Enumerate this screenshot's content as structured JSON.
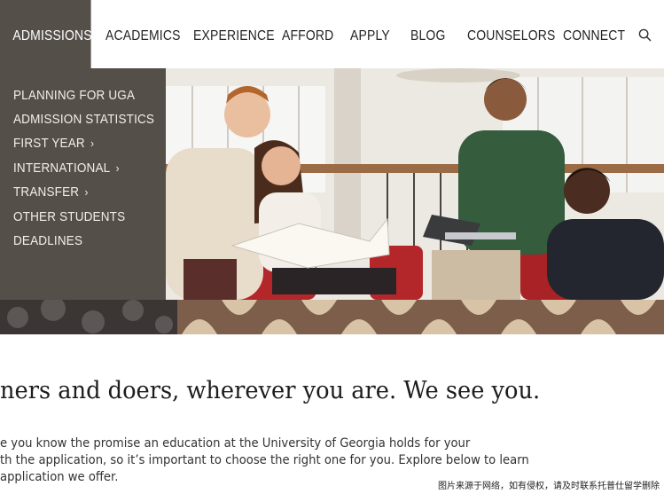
{
  "nav": {
    "items": [
      {
        "label": "ADMISSIONS"
      },
      {
        "label": "ACADEMICS"
      },
      {
        "label": "EXPERIENCE"
      },
      {
        "label": "AFFORD"
      },
      {
        "label": "APPLY"
      },
      {
        "label": "BLOG"
      },
      {
        "label": "COUNSELORS"
      },
      {
        "label": "CONNECT"
      }
    ],
    "search_icon": "search-icon"
  },
  "dropdown": {
    "items": [
      {
        "label": "PLANNING FOR UGA"
      },
      {
        "label": "ADMISSION STATISTICS"
      },
      {
        "label": "FIRST YEAR",
        "chevron": "›"
      },
      {
        "label": "INTERNATIONAL",
        "chevron": "›"
      },
      {
        "label": "TRANSFER",
        "chevron": "›"
      },
      {
        "label": "OTHER STUDENTS"
      },
      {
        "label": "DEADLINES"
      }
    ]
  },
  "main": {
    "headline": "ners and doers, wherever you are. We see you.",
    "body_lines": [
      "e you know the promise an education at the University of Georgia holds for your",
      "th the application, so it’s important to choose the right one for you. Explore below to learn",
      "application we offer."
    ]
  },
  "watermark": "图片来源于网络，如有侵权，请及时联系托普仕留学删除",
  "colors": {
    "active_nav_bg": "#554f4a",
    "dropdown_bg": "#554f4a",
    "nav_text": "#222222",
    "dropdown_text": "#f2efe9"
  }
}
